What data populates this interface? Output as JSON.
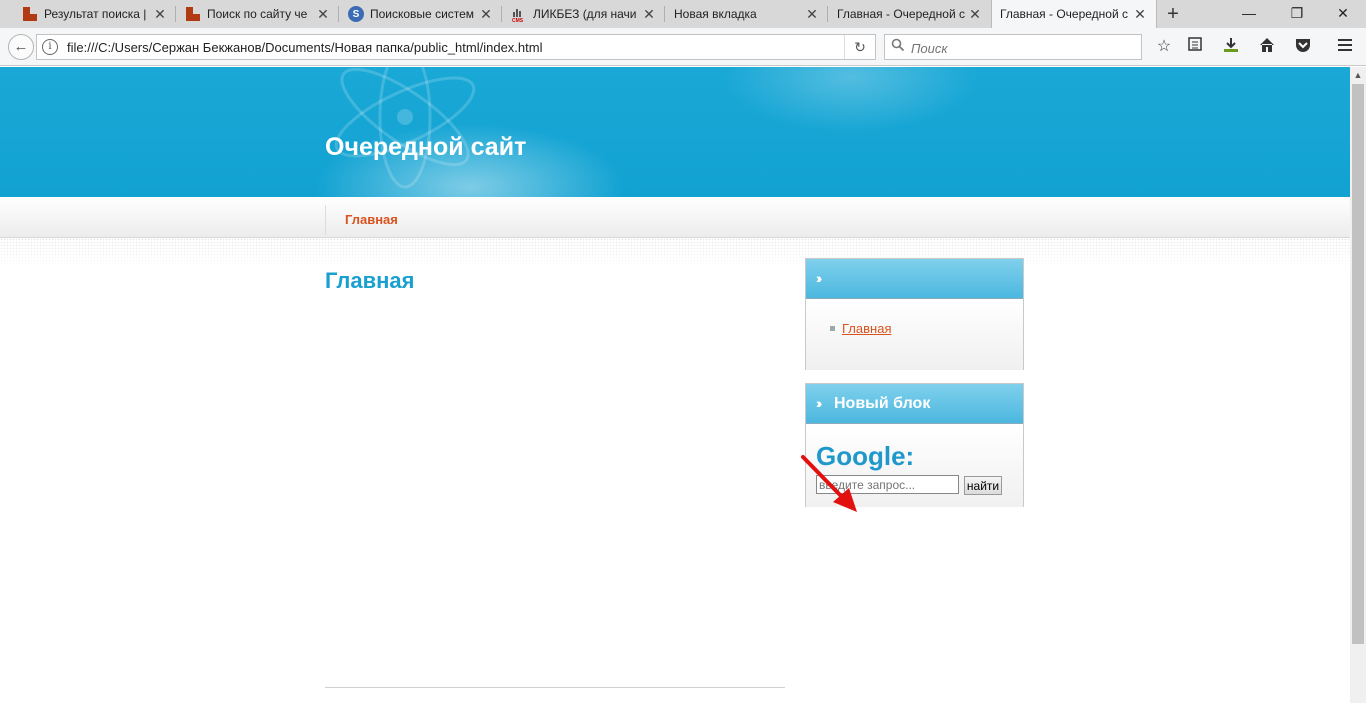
{
  "browser": {
    "tabs": [
      {
        "title": "Результат поиска |",
        "icon": "grid-favicon-icon"
      },
      {
        "title": "Поиск по сайту че",
        "icon": "grid-favicon-icon"
      },
      {
        "title": "Поисковые систем",
        "icon": "s-favicon-icon",
        "glyph": "S"
      },
      {
        "title": "ЛИКБЕЗ (для начи",
        "icon": "cms-favicon-icon",
        "glyph": "CMS"
      },
      {
        "title": "Новая вкладка",
        "icon": ""
      },
      {
        "title": "Главная - Очередной с",
        "icon": ""
      },
      {
        "title": "Главная - Очередной с",
        "icon": "",
        "active": true
      }
    ],
    "close_glyph": "✕",
    "new_tab_glyph": "+",
    "window": {
      "minimize": "—",
      "restore": "❐",
      "close": "✕"
    },
    "address": "file:///C:/Users/Сержан Бекжанов/Documents/Новая папка/public_html/index.html",
    "search_placeholder": "Поиск",
    "toolbar_icons": [
      "star-icon",
      "reading-list-icon",
      "download-icon",
      "home-icon",
      "pocket-icon",
      "menu-icon"
    ]
  },
  "site": {
    "title": "Очередной сайт",
    "menu": [
      "Главная"
    ],
    "content_title": "Главная",
    "blocks": [
      {
        "title": "",
        "links": [
          "Главная"
        ]
      },
      {
        "title": "Новый блок",
        "google_label": "Google:",
        "search_placeholder": "введите запрос...",
        "button": "найти"
      }
    ]
  },
  "colors": {
    "header_blue": "#12a2d2",
    "menu_link": "#d9531e",
    "title_blue": "#1aa0cf",
    "annotation_arrow": "#e31010"
  }
}
